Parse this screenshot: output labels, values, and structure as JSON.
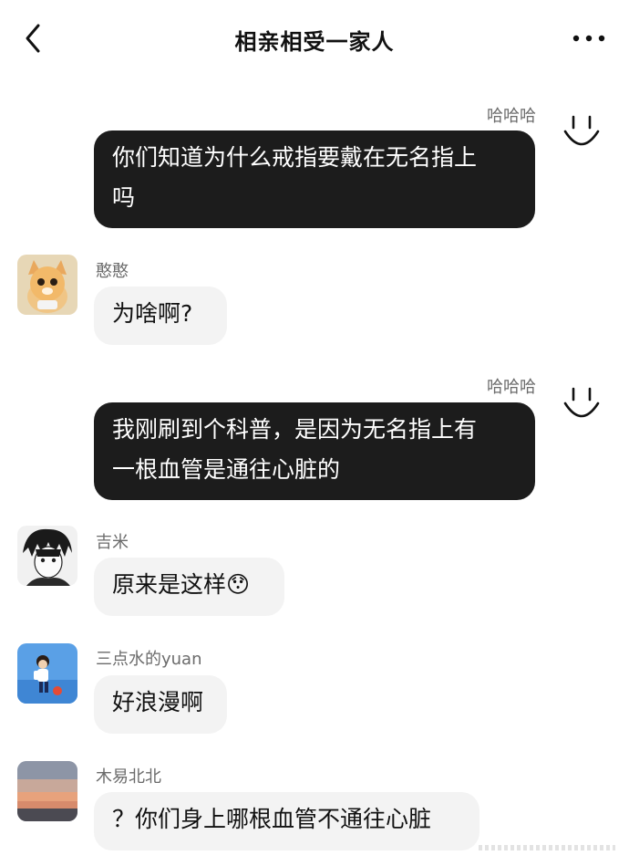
{
  "header": {
    "title": "相亲相受一家人"
  },
  "messages": [
    {
      "sender": "哈哈哈",
      "text_lines": [
        "你们知道为什么戒指要戴在无名指上",
        "吗"
      ],
      "side": "right"
    },
    {
      "sender": "憨憨",
      "text_lines": [
        "为啥啊?"
      ],
      "side": "left"
    },
    {
      "sender": "哈哈哈",
      "text_lines": [
        "我刚刷到个科普，是因为无名指上有",
        "一根血管是通往心脏的"
      ],
      "side": "right"
    },
    {
      "sender": "吉米",
      "text_lines": [
        "原来是这样😯"
      ],
      "side": "left"
    },
    {
      "sender": "三点水的yuan",
      "text_lines": [
        "好浪漫啊"
      ],
      "side": "left"
    },
    {
      "sender": "木易北北",
      "text_lines": [
        "？你们身上哪根血管不通往心脏"
      ],
      "side": "left"
    }
  ],
  "icons": {
    "back": "chevron-left-icon",
    "more": "more-horizontal-icon",
    "self_avatar": "smiley-face-icon"
  },
  "colors": {
    "own_bubble": "#1c1c1c",
    "other_bubble": "#f3f3f3",
    "sender_name": "#6b6b6b"
  }
}
